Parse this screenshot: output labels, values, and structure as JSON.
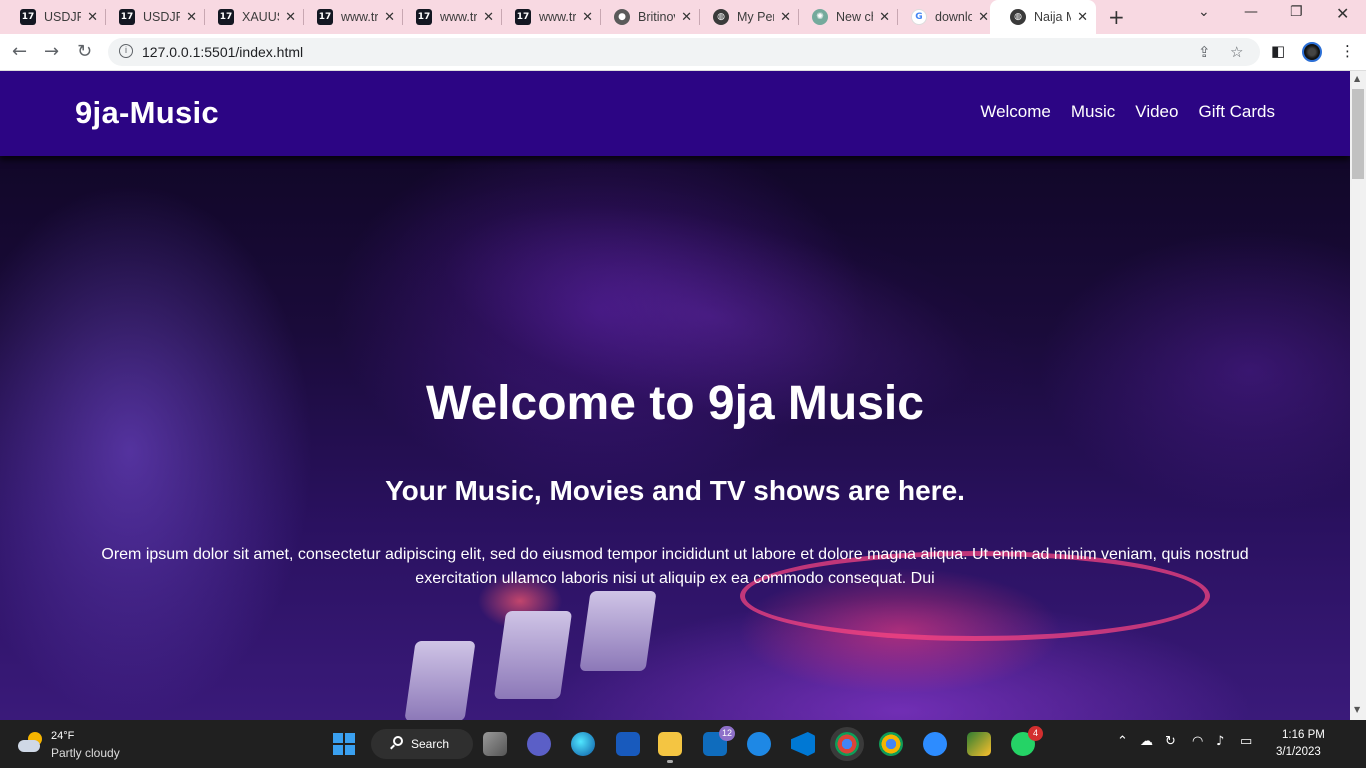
{
  "browser": {
    "tabs": [
      {
        "label": "USDJPY",
        "favicon": "tradingview-icon"
      },
      {
        "label": "USDJPY",
        "favicon": "tradingview-icon"
      },
      {
        "label": "XAUUSD",
        "favicon": "tradingview-icon"
      },
      {
        "label": "www.tradingview.com",
        "favicon": "tradingview-icon"
      },
      {
        "label": "www.tradingview.com",
        "favicon": "tradingview-icon"
      },
      {
        "label": "www.tradingview.com",
        "favicon": "tradingview-icon"
      },
      {
        "label": "Britinovation",
        "favicon": "github-icon"
      },
      {
        "label": "My Personal",
        "favicon": "globe-icon"
      },
      {
        "label": "New chat",
        "favicon": "chatgpt-icon"
      },
      {
        "label": "download",
        "favicon": "google-icon"
      },
      {
        "label": "Naija Music",
        "favicon": "globe-icon",
        "active": true
      }
    ],
    "url": "127.0.0.1:5501/index.html"
  },
  "site": {
    "brand": "9ja-Music",
    "nav": [
      "Welcome",
      "Music",
      "Video",
      "Gift Cards"
    ],
    "hero": {
      "title": "Welcome to 9ja Music",
      "subtitle": "Your Music, Movies and TV shows are here.",
      "text": "Orem ipsum dolor sit amet, consectetur adipiscing elit, sed do eiusmod tempor incididunt ut labore et dolore magna aliqua. Ut enim ad minim veniam, quis nostrud exercitation ullamco laboris nisi ut aliquip ex ea commodo consequat. Dui"
    },
    "colors": {
      "navbar": "#2c0584",
      "text": "#ffffff"
    }
  },
  "taskbar": {
    "weather": {
      "temp": "24°F",
      "condition": "Partly cloudy"
    },
    "search_label": "Search",
    "mail_badge": "12",
    "whatsapp_badge": "4",
    "time": "1:16 PM",
    "date": "3/1/2023"
  }
}
